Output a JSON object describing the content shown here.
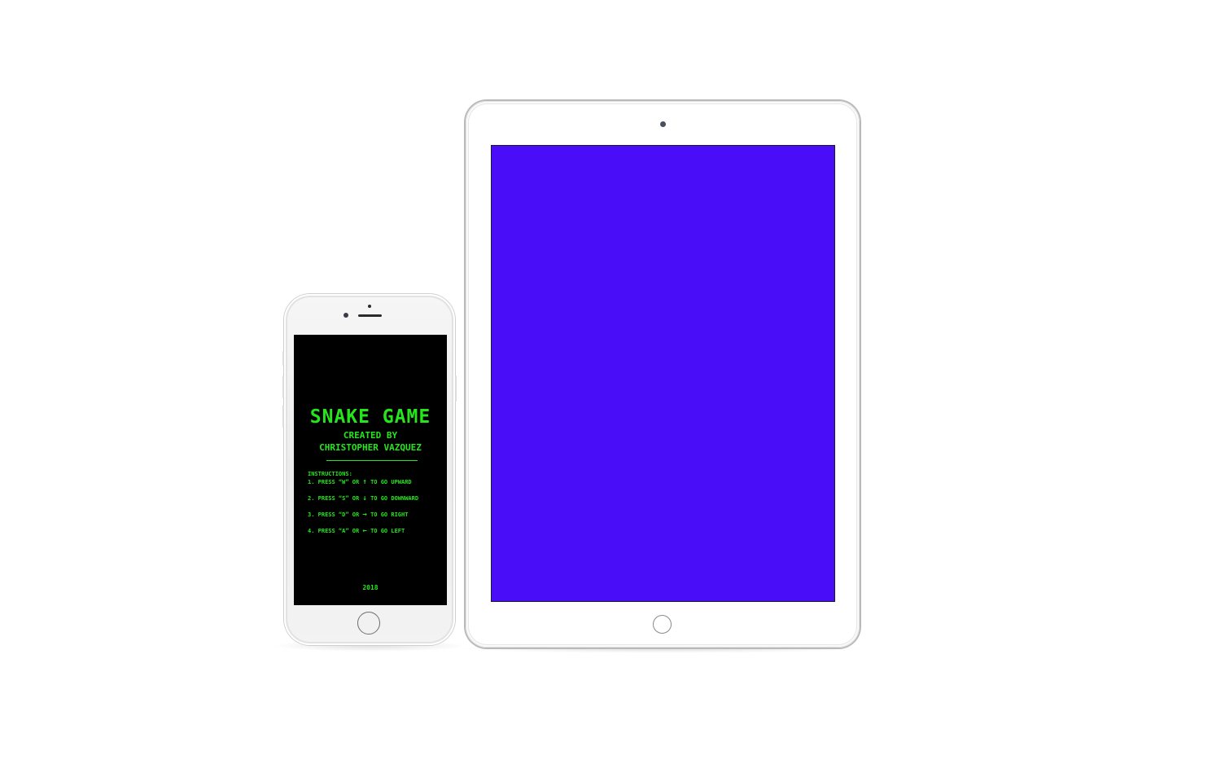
{
  "phone": {
    "game": {
      "title": "SNAKE GAME",
      "credit_line1": "CREATED BY",
      "credit_line2": "CHRISTOPHER VAZQUEZ",
      "instructions_heading": "INSTRUCTIONS:",
      "instructions": [
        {
          "prefix": "1. PRESS “W” OR ",
          "arrow": "↑",
          "suffix": " TO GO UPWARD",
          "arrow_icon": "arrow-up-icon"
        },
        {
          "prefix": "2. PRESS “S” OR ",
          "arrow": "↓",
          "suffix": " TO GO DOWNWARD",
          "arrow_icon": "arrow-down-icon"
        },
        {
          "prefix": "3. PRESS “D” OR ",
          "arrow": "→",
          "suffix": " TO GO RIGHT",
          "arrow_icon": "arrow-right-icon"
        },
        {
          "prefix": "4. PRESS “A” OR ",
          "arrow": "←",
          "suffix": " TO GO LEFT",
          "arrow_icon": "arrow-left-icon"
        }
      ],
      "year": "2018",
      "text_color": "#25e61c",
      "background_color": "#000000"
    }
  },
  "tablet": {
    "screen_color": "#4a0df7"
  }
}
